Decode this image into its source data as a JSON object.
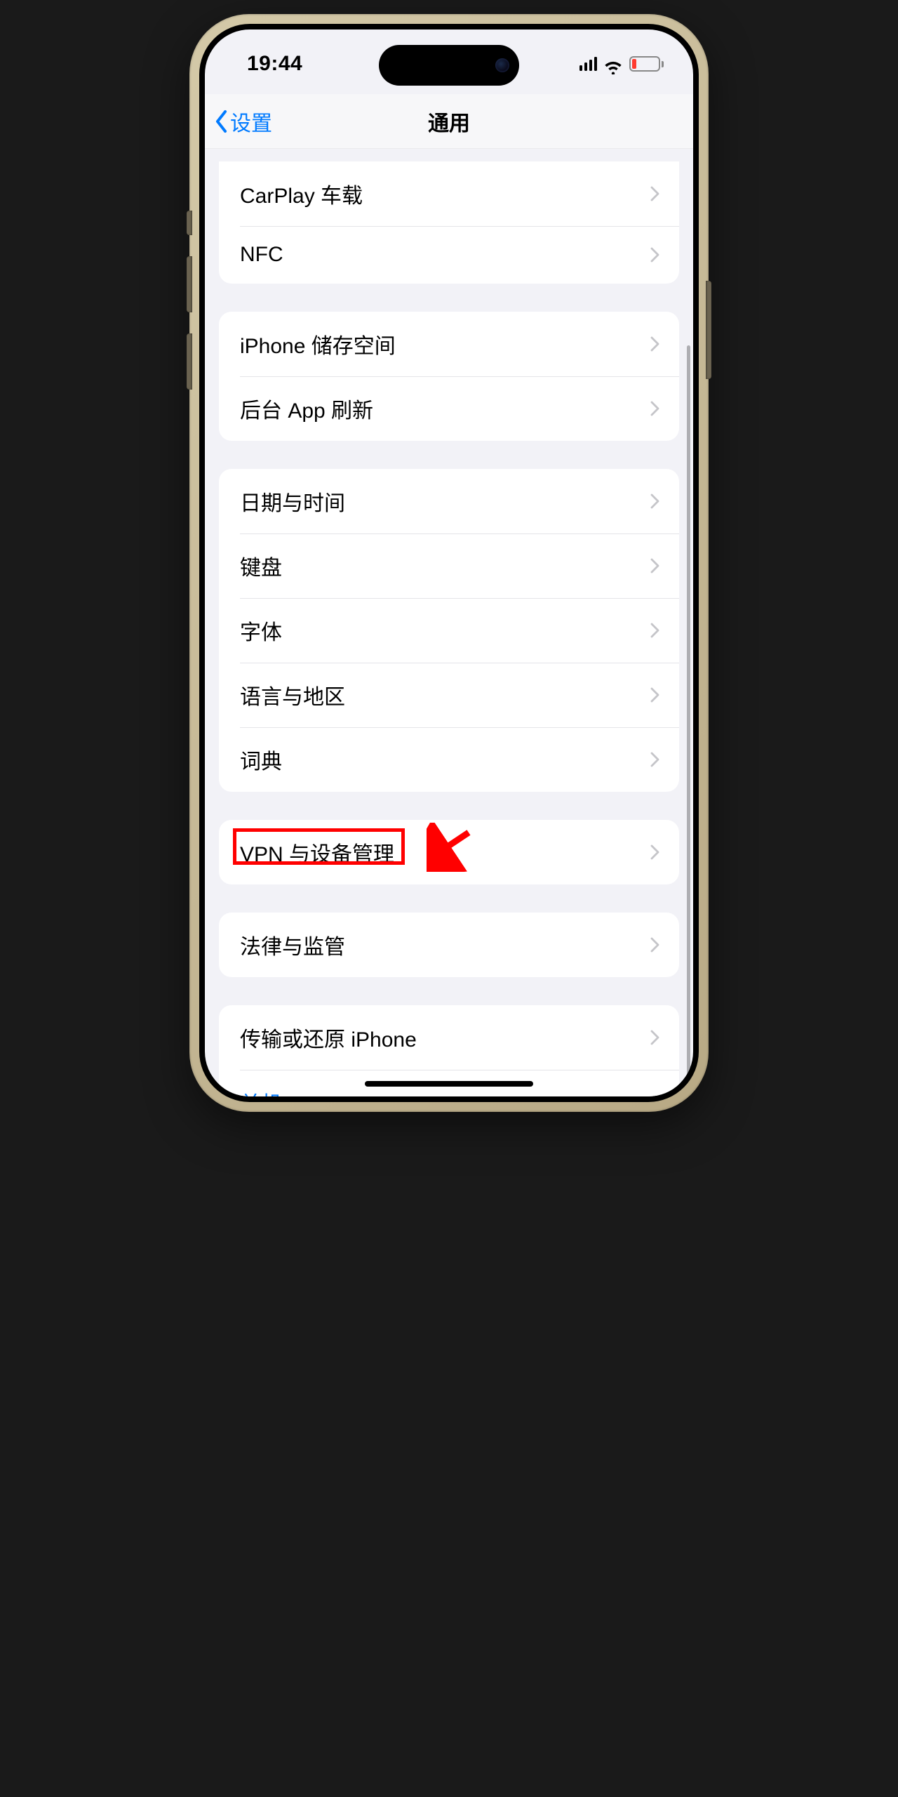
{
  "statusBar": {
    "time": "19:44"
  },
  "nav": {
    "back": "设置",
    "title": "通用"
  },
  "groups": [
    {
      "rows": [
        {
          "label": "CarPlay 车载",
          "chevron": true
        },
        {
          "label": "NFC",
          "chevron": true
        }
      ]
    },
    {
      "rows": [
        {
          "label": "iPhone 储存空间",
          "chevron": true
        },
        {
          "label": "后台 App 刷新",
          "chevron": true
        }
      ]
    },
    {
      "rows": [
        {
          "label": "日期与时间",
          "chevron": true
        },
        {
          "label": "键盘",
          "chevron": true
        },
        {
          "label": "字体",
          "chevron": true
        },
        {
          "label": "语言与地区",
          "chevron": true
        },
        {
          "label": "词典",
          "chevron": true
        }
      ]
    },
    {
      "rows": [
        {
          "label": "VPN 与设备管理",
          "chevron": true
        }
      ]
    },
    {
      "rows": [
        {
          "label": "法律与监管",
          "chevron": true
        }
      ]
    },
    {
      "rows": [
        {
          "label": "传输或还原 iPhone",
          "chevron": true
        },
        {
          "label": "关机",
          "chevron": false,
          "action": true
        }
      ]
    }
  ]
}
